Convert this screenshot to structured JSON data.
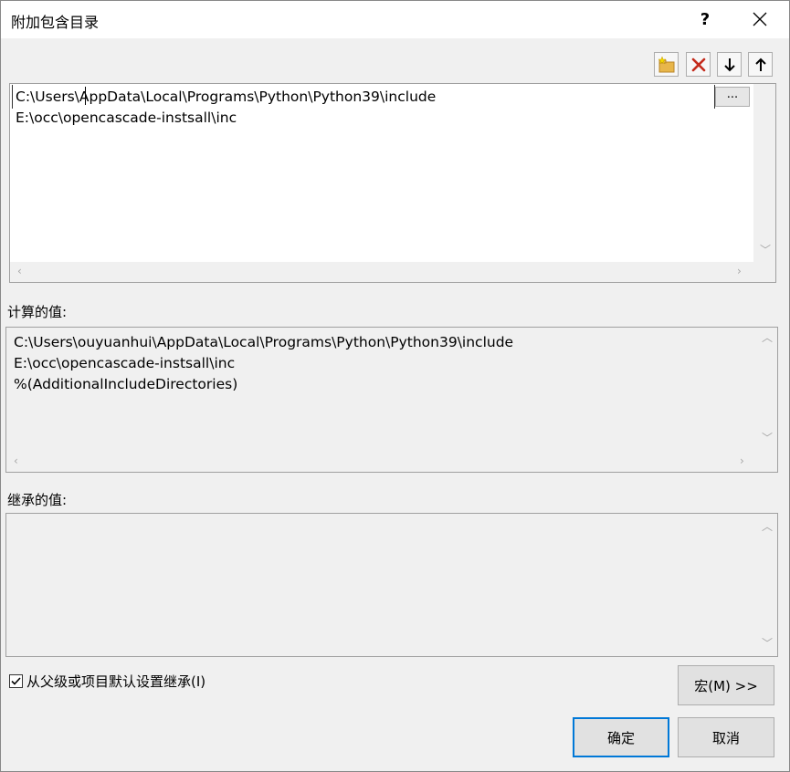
{
  "window": {
    "title": "附加包含目录",
    "help_label": "?"
  },
  "toolbar": {
    "new_line": "new-folder-icon",
    "delete": "delete-icon",
    "move_down": "arrow-down-icon",
    "move_up": "arrow-up-icon"
  },
  "edit_list": {
    "items": [
      "C:\\Users\\AppData\\Local\\Programs\\Python\\Python39\\include",
      "E:\\occ\\opencascade-instsall\\inc"
    ],
    "browse_label": "..."
  },
  "evaluated": {
    "label": "计算的值:",
    "lines": [
      "C:\\Users\\ouyuanhui\\AppData\\Local\\Programs\\Python\\Python39\\include",
      "E:\\occ\\opencascade-instsall\\inc",
      "%(AdditionalIncludeDirectories)"
    ]
  },
  "inherited": {
    "label": "继承的值:",
    "lines": []
  },
  "inherit_checkbox": {
    "label": "从父级或项目默认设置继承(I)",
    "checked": true
  },
  "buttons": {
    "macros": "宏(M) >>",
    "ok": "确定",
    "cancel": "取消"
  },
  "colors": {
    "accent": "#0078d7",
    "delete_red": "#c42b1c",
    "folder_yellow": "#e8b64a"
  }
}
